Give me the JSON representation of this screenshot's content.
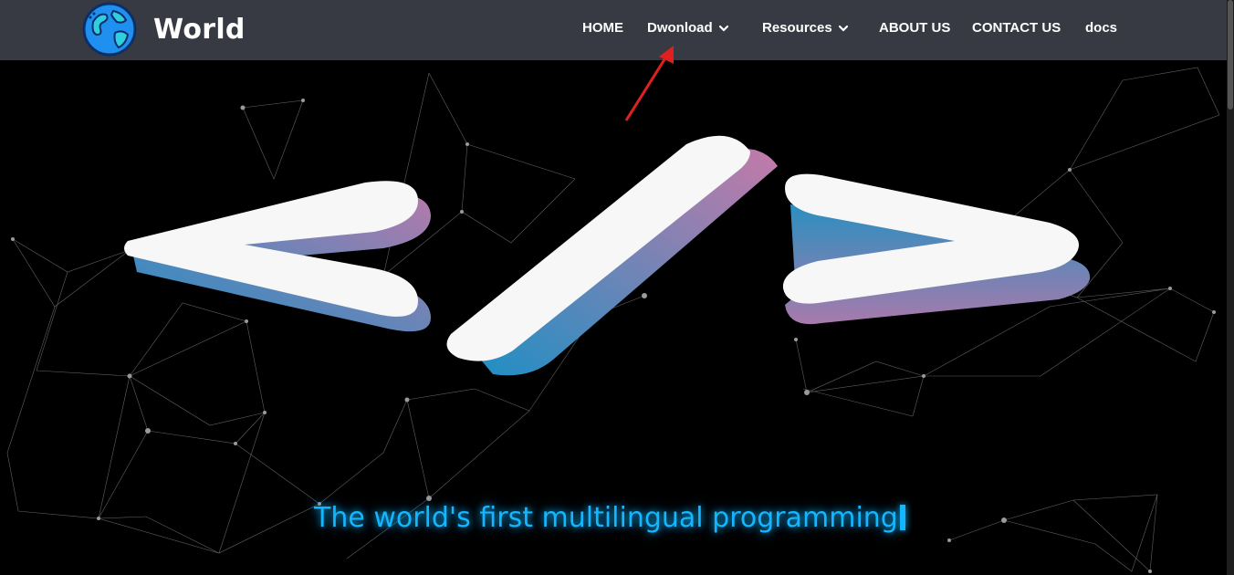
{
  "brand": {
    "name": "World",
    "logo_icon": "globe-icon"
  },
  "nav": {
    "items": [
      {
        "label": "HOME",
        "has_dropdown": false
      },
      {
        "label": "Dwonload",
        "has_dropdown": true
      },
      {
        "label": "Resources",
        "has_dropdown": true
      },
      {
        "label": "ABOUT US",
        "has_dropdown": false
      },
      {
        "label": "CONTACT US",
        "has_dropdown": false
      },
      {
        "label": "docs",
        "has_dropdown": false
      }
    ]
  },
  "hero": {
    "tagline": "The world's first multilingual programming"
  },
  "colors": {
    "navbar_bg": "#373a42",
    "page_bg": "#000000",
    "tagline": "#13b6ff",
    "annotation_arrow": "#e0201e"
  }
}
